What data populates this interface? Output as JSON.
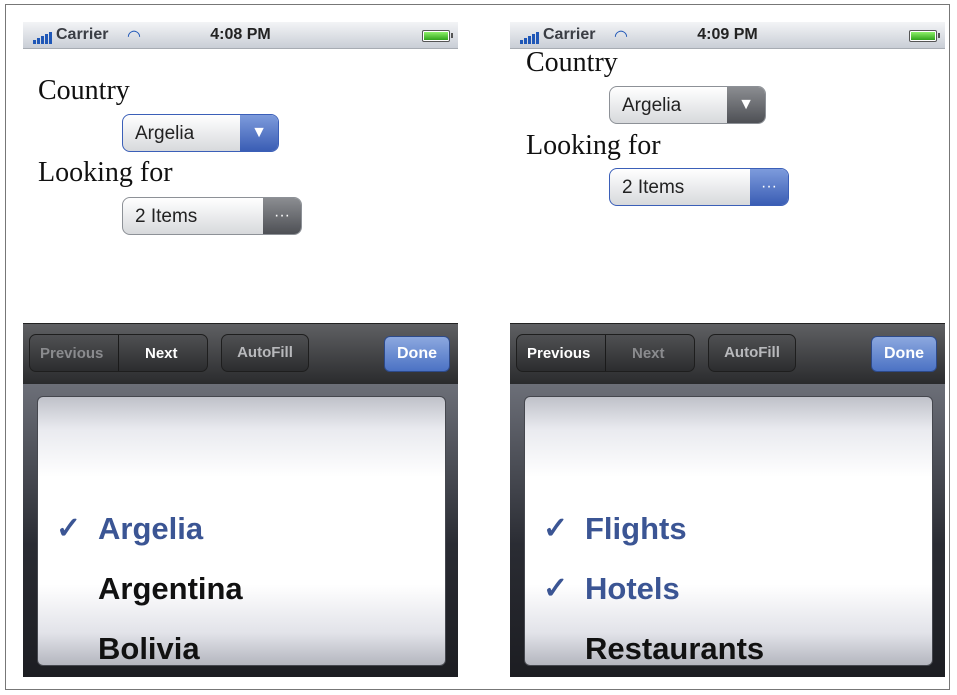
{
  "left": {
    "status": {
      "carrier": "Carrier",
      "time": "4:08 PM"
    },
    "form": {
      "country_label": "Country",
      "country_value": "Argelia",
      "looking_label": "Looking for",
      "looking_value": "2 Items"
    },
    "toolbar": {
      "previous": "Previous",
      "next": "Next",
      "autofill": "AutoFill",
      "done": "Done"
    },
    "picker": [
      {
        "label": "Argelia",
        "checked": true
      },
      {
        "label": "Argentina",
        "checked": false
      },
      {
        "label": "Bolivia",
        "checked": false
      }
    ]
  },
  "right": {
    "status": {
      "carrier": "Carrier",
      "time": "4:09 PM"
    },
    "form": {
      "country_label": "Country",
      "country_value": "Argelia",
      "looking_label": "Looking for",
      "looking_value": "2 Items"
    },
    "toolbar": {
      "previous": "Previous",
      "next": "Next",
      "autofill": "AutoFill",
      "done": "Done"
    },
    "picker": [
      {
        "label": "Flights",
        "checked": true
      },
      {
        "label": "Hotels",
        "checked": true
      },
      {
        "label": "Restaurants",
        "checked": false
      }
    ]
  },
  "icons": {
    "signal": "signal-bars-icon",
    "wifi": "wifi-icon",
    "battery": "battery-icon",
    "dropdown": "triangle-down-icon",
    "multi": "ellipsis-icon",
    "check": "checkmark-icon"
  },
  "colors": {
    "accent": "#3b5594",
    "focus": "#3a5db4",
    "toolbar": "#2a2b2d"
  }
}
